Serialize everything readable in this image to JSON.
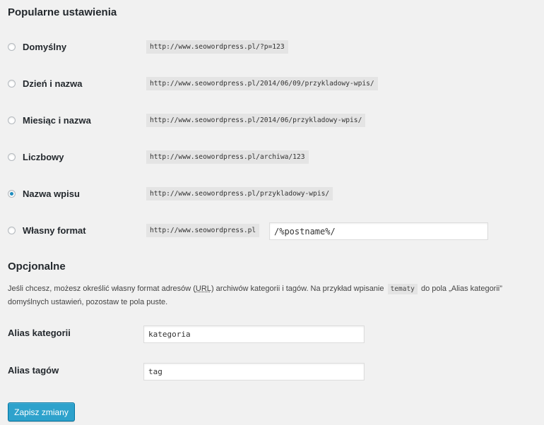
{
  "headings": {
    "popular": "Popularne ustawienia",
    "optional": "Opcjonalne"
  },
  "permalinks": {
    "selected": "nazwa-wpisu",
    "options": [
      {
        "label": "Domyślny",
        "example": "http://www.seowordpress.pl/?p=123",
        "checked": false
      },
      {
        "label": "Dzień i nazwa",
        "example": "http://www.seowordpress.pl/2014/06/09/przykladowy-wpis/",
        "checked": false
      },
      {
        "label": "Miesiąc i nazwa",
        "example": "http://www.seowordpress.pl/2014/06/przykladowy-wpis/",
        "checked": false
      },
      {
        "label": "Liczbowy",
        "example": "http://www.seowordpress.pl/archiwa/123",
        "checked": false
      },
      {
        "label": "Nazwa wpisu",
        "example": "http://www.seowordpress.pl/przykladowy-wpis/",
        "checked": true
      }
    ],
    "custom": {
      "label": "Własny format",
      "prefix": "http://www.seowordpress.pl",
      "value": "/%postname%/",
      "checked": false
    }
  },
  "optional": {
    "description_part1": "Jeśli chcesz, możesz określić własny format adresów (",
    "description_abbr": "URL",
    "description_part2": ") archiwów kategorii i tagów. Na przykład wpisanie",
    "description_code": "tematy",
    "description_part3": "do pola „Alias kategorii”",
    "description_line2": "domyślnych ustawień, pozostaw te pola puste.",
    "category_base_label": "Alias kategorii",
    "category_base_value": "kategoria",
    "tag_base_label": "Alias tagów",
    "tag_base_value": "tag"
  },
  "submit_label": "Zapisz zmiany",
  "colors": {
    "background": "#f1f1f1",
    "code_background": "#e4e4e4",
    "primary_button": "#2ea2cc",
    "radio_checked": "#1e8cbe"
  }
}
